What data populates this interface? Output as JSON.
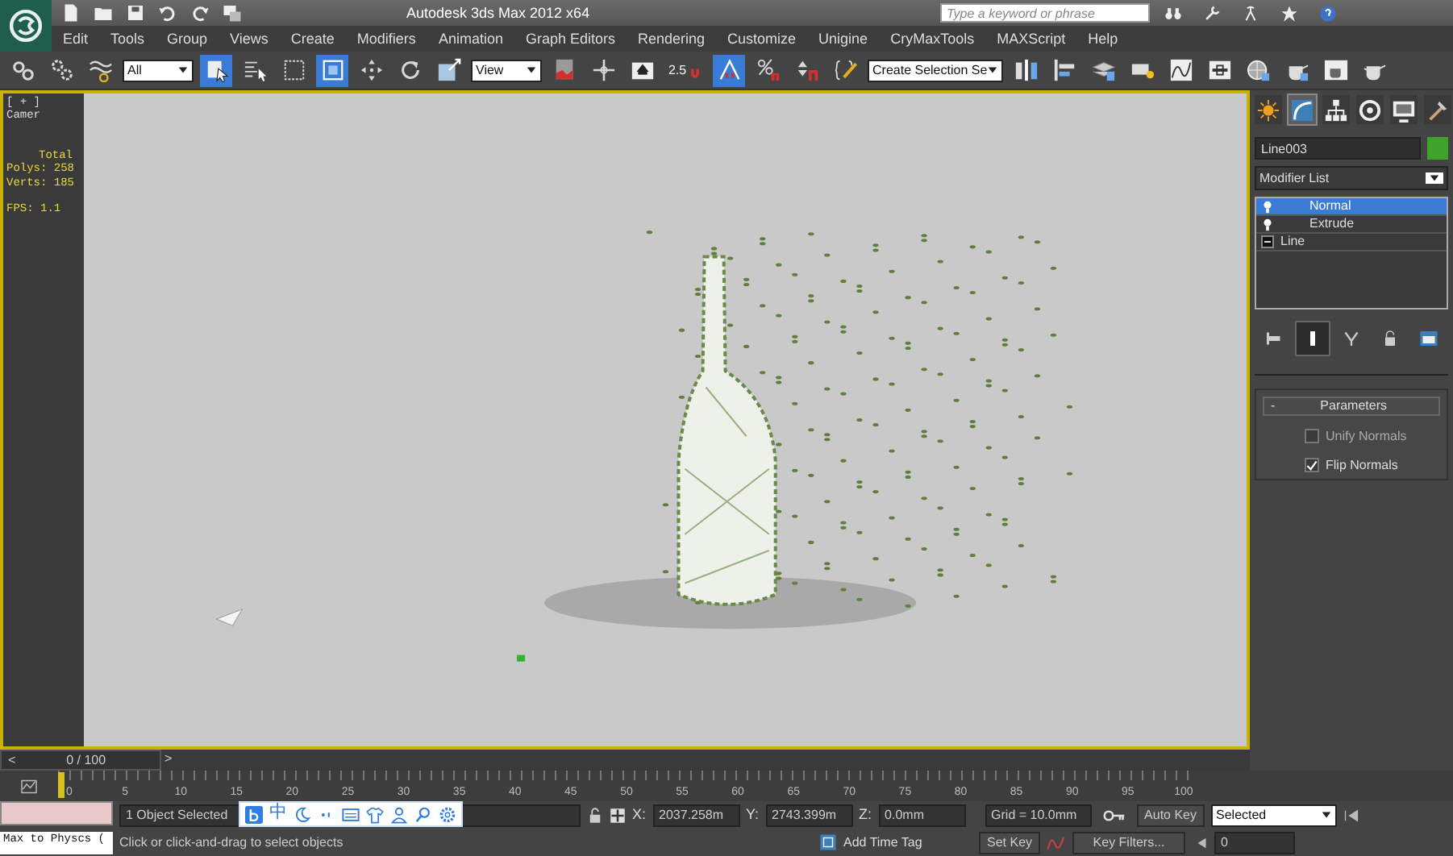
{
  "title_bar": {
    "title": "Autodesk 3ds Max  2012 x64",
    "search": {
      "placeholder": "Type a keyword or phrase"
    }
  },
  "menu": [
    "Edit",
    "Tools",
    "Group",
    "Views",
    "Create",
    "Modifiers",
    "Animation",
    "Graph Editors",
    "Rendering",
    "Customize",
    "Unigine",
    "CryMaxTools",
    "MAXScript",
    "Help"
  ],
  "toolbar": [
    {
      "kind": "link",
      "on": false
    },
    {
      "kind": "unlink",
      "on": false
    },
    {
      "kind": "bind",
      "on": false
    },
    {
      "kind": "dropdown",
      "value": "All"
    },
    {
      "kind": "select",
      "on": true
    },
    {
      "kind": "select_name",
      "on": false
    },
    {
      "kind": "rect_region",
      "on": false
    },
    {
      "kind": "window_crossing",
      "on": true
    },
    {
      "kind": "move",
      "on": false
    },
    {
      "kind": "rotate",
      "on": false
    },
    {
      "kind": "scale",
      "on": false
    },
    {
      "kind": "dropdown",
      "value": "View"
    },
    {
      "kind": "pivot",
      "on": false
    },
    {
      "kind": "manipulate",
      "on": false
    },
    {
      "kind": "keyboard",
      "on": false
    },
    {
      "kind": "snap",
      "label": "2.5",
      "on": false
    },
    {
      "kind": "angle_snap",
      "on": true
    },
    {
      "kind": "percent_snap",
      "on": false
    },
    {
      "kind": "spinner_snap",
      "on": false
    },
    {
      "kind": "named_sets",
      "on": false
    },
    {
      "kind": "dropdown",
      "value": "Create Selection Se"
    },
    {
      "kind": "mirror",
      "on": false
    },
    {
      "kind": "align",
      "on": false
    },
    {
      "kind": "layers",
      "on": false
    },
    {
      "kind": "ribbon",
      "on": false
    },
    {
      "kind": "curve_editor",
      "on": false
    },
    {
      "kind": "schematic",
      "on": false
    },
    {
      "kind": "material",
      "on": false
    },
    {
      "kind": "render_setup",
      "on": false
    },
    {
      "kind": "render_frame",
      "on": false
    },
    {
      "kind": "render",
      "on": false
    }
  ],
  "viewport": {
    "label": "[ + ] Camer",
    "stats": [
      "Total",
      "Polys: 258",
      "Verts: 185",
      "FPS:   1.1"
    ]
  },
  "command_panel": {
    "tabs": [
      {
        "kind": "create",
        "selected": false
      },
      {
        "kind": "modify",
        "selected": true
      },
      {
        "kind": "hierarchy",
        "selected": false
      },
      {
        "kind": "motion",
        "selected": false
      },
      {
        "kind": "display",
        "selected": false
      },
      {
        "kind": "utilities",
        "selected": false
      }
    ],
    "object_name": "Line003",
    "modifier_list": "Modifier List",
    "stack": [
      {
        "label": "Normal",
        "kind": "modifier",
        "selected": true
      },
      {
        "label": "Extrude",
        "kind": "modifier",
        "selected": false
      },
      {
        "label": "Line",
        "kind": "base",
        "selected": false
      }
    ],
    "rollout": {
      "toggle": "-",
      "title": "Parameters",
      "options": [
        {
          "label": "Unify Normals",
          "checked": false
        },
        {
          "label": "Flip Normals",
          "checked": true
        }
      ]
    }
  },
  "time_slider": {
    "label": "0 / 100",
    "level": 0,
    "prev": "<",
    "next": ">"
  },
  "track_bar": {
    "ticks": [
      "0",
      "5",
      "10",
      "15",
      "20",
      "25",
      "30",
      "35",
      "40",
      "45",
      "50",
      "55",
      "60",
      "65",
      "70",
      "75",
      "80",
      "85",
      "90",
      "95",
      "100"
    ]
  },
  "status": {
    "script_listener": "Max to Physcs (",
    "selection": "1 Object Selected",
    "prompt": "Click or click-and-drag to select objects",
    "x_label": "X:",
    "x": "2037.258m",
    "y_label": "Y:",
    "y": "2743.399m",
    "z_label": "Z:",
    "z": "0.0mm",
    "grid": "Grid = 10.0mm",
    "time_tag": "Add Time Tag"
  },
  "ime_bar": {
    "mode": "中"
  },
  "animation": {
    "auto_key": "Auto Key",
    "key_mode": "Selected",
    "set_key": "Set Key",
    "key_filters": "Key Filters...",
    "frame": "0"
  }
}
